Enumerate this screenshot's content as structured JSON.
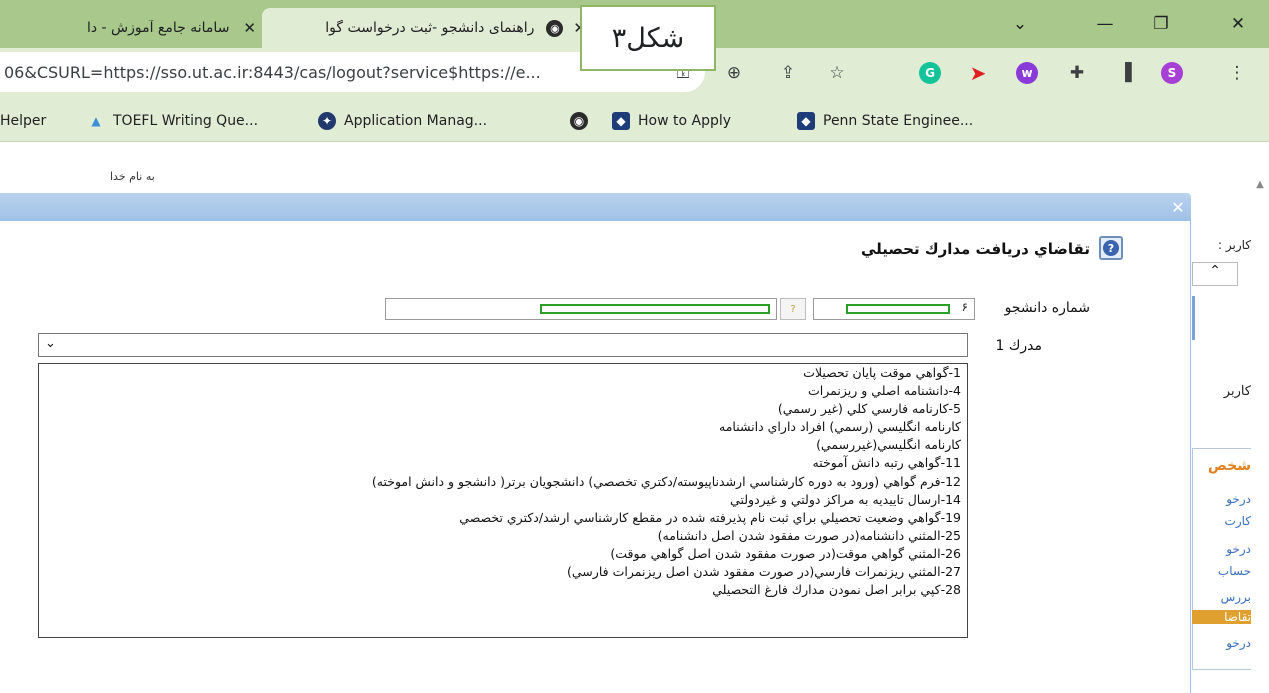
{
  "browser": {
    "tabs": [
      {
        "title": "سامانه جامع آموزش - دا",
        "active": false
      },
      {
        "title": "راهنمای دانشجو -ثبت درخواست گوا",
        "active": true
      }
    ],
    "close_glyph": "✕",
    "window_controls": {
      "minimize": "—",
      "restore": "❐",
      "close": "✕",
      "tabsearch": "⌄"
    },
    "address": "06&CSURL=https://sso.ut.ac.ir:8443/cas/logout?service$https://e...",
    "profile_initial": "S",
    "bookmarks": [
      {
        "label": "Helper"
      },
      {
        "label": "TOEFL Writing Que..."
      },
      {
        "label": "Application Manag..."
      },
      {
        "label": ""
      },
      {
        "label": "How to Apply"
      },
      {
        "label": "Penn State Enginee..."
      }
    ]
  },
  "overlay_label": "شکل۳",
  "page": {
    "basmala": "به نام خدا",
    "form_title": "تقاضاي دريافت مدارك تحصيلي",
    "student_number_label": "شماره دانشجو",
    "student_number_prefix": "۶",
    "doc_label": "مدرك 1",
    "modal_close": "✕",
    "dropdown_options": [
      "1-گواهي موقت پايان تحصيلات",
      "4-دانشنامه اصلي و ريزنمرات",
      "5-كارنامه فارسي كلي (غير رسمي)",
      "كارنامه انگليسي (رسمي) افراد داراي دانشنامه",
      "كارنامه انگليسي(غيررسمي)",
      "11-گواهي رتبه دانش آموخته",
      "12-فرم گواهي (ورود به دوره كارشناسي ارشدناپيوسته/دكتري تخصصي) دانشجويان برتر( دانشجو و دانش اموخته)",
      "14-ارسال تاييديه به مراكز دولتي و غيردولتي",
      "19-گواهي وضعيت تحصيلي براي ثبت نام پذيرفته شده در مقطع كارشناسي ارشد/دكتري تخصصي",
      "25-المثني دانشنامه(در صورت مفقود شدن اصل دانشنامه)",
      "26-المثني گواهي موقت(در صورت مفقود شدن اصل گواهي موقت)",
      "27-المثني ريزنمرات فارسي(در صورت مفقود شدن اصل ريزنمرات فارسي)",
      "28-كپي برابر اصل نمودن مدارك فارغ التحصيلي"
    ],
    "right_panel": {
      "user_label": "كاربر :",
      "user_label2": "كاربر",
      "section": "شخص",
      "items": [
        "درخو",
        "كارت",
        "درخو",
        "حساب",
        "بررس",
        "تقاضا",
        "درخو"
      ]
    }
  },
  "colors": {
    "tabstrip": "#a8c98b",
    "toolbar": "#e1ecd5",
    "modal_header": "#9fc0e6",
    "highlight": "#e0a030",
    "green_redaction": "#2aa02a"
  }
}
